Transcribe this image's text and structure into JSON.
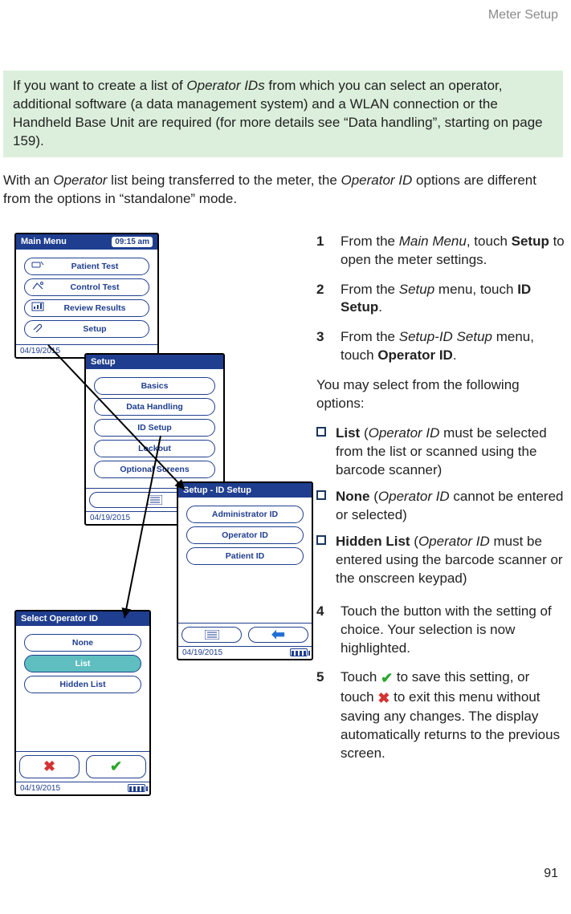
{
  "running_head": "Meter Setup",
  "page_number": "91",
  "info_box": {
    "text_before_italic1": "If you want to create a list of ",
    "italic1": "Operator IDs",
    "text_mid": " from which you can select an operator, additional software (a data management system) and a WLAN connection or the Handheld Base Unit are required (for more details see “Data handling”, starting on page 159)."
  },
  "intro": {
    "t1": "With an ",
    "i1": "Operator",
    "t2": " list being transferred to the meter, the ",
    "i2": "Operator ID",
    "t3": " options are different from the options in “standalone” mode."
  },
  "steps": {
    "s1": {
      "n": "1",
      "a": "From the ",
      "i": "Main Menu",
      "b": ", touch ",
      "bold": "Setup",
      "c": " to open the meter settings."
    },
    "s2": {
      "n": "2",
      "a": "From the ",
      "i": "Setup",
      "b": " menu, touch ",
      "bold": "ID Setup",
      "c": "."
    },
    "s3": {
      "n": "3",
      "a": "From the ",
      "i": "Setup-ID Setup",
      "b": " menu, touch ",
      "bold": "Operator ID",
      "c": "."
    },
    "s4": {
      "n": "4",
      "t": "Touch the button with the setting of choice. Your selection is now highlighted."
    },
    "s5": {
      "n": "5",
      "a": "Touch ",
      "b": " to save this setting, or touch ",
      "c": " to exit this menu without saving any changes. The display automatically returns to the previous screen."
    }
  },
  "options_intro": "You may select from the following options:",
  "options": {
    "o1": {
      "bold": "List",
      "a": " (",
      "i": "Operator ID",
      "b": " must be selected from the list or scanned using the barcode scanner)"
    },
    "o2": {
      "bold": "None",
      "a": " (",
      "i": "Operator ID",
      "b": " cannot be entered or selected)"
    },
    "o3": {
      "bold": "Hidden List",
      "a": " (",
      "i": "Operator ID",
      "b": " must be entered using the barcode scanner or the onscreen keypad)"
    }
  },
  "devices": {
    "main": {
      "title": "Main Menu",
      "time": "09:15 am",
      "date": "04/19/2015",
      "items": [
        "Patient Test",
        "Control Test",
        "Review Results",
        "Setup"
      ]
    },
    "setup": {
      "title": "Setup",
      "date": "04/19/2015",
      "items": [
        "Basics",
        "Data Handling",
        "ID Setup",
        "Lockout",
        "Optional Screens"
      ]
    },
    "idsetup": {
      "title": "Setup - ID Setup",
      "date": "04/19/2015",
      "items": [
        "Administrator ID",
        "Operator ID",
        "Patient ID"
      ]
    },
    "select": {
      "title": "Select Operator ID",
      "date": "04/19/2015",
      "items": [
        "None",
        "List",
        "Hidden List"
      ]
    }
  }
}
